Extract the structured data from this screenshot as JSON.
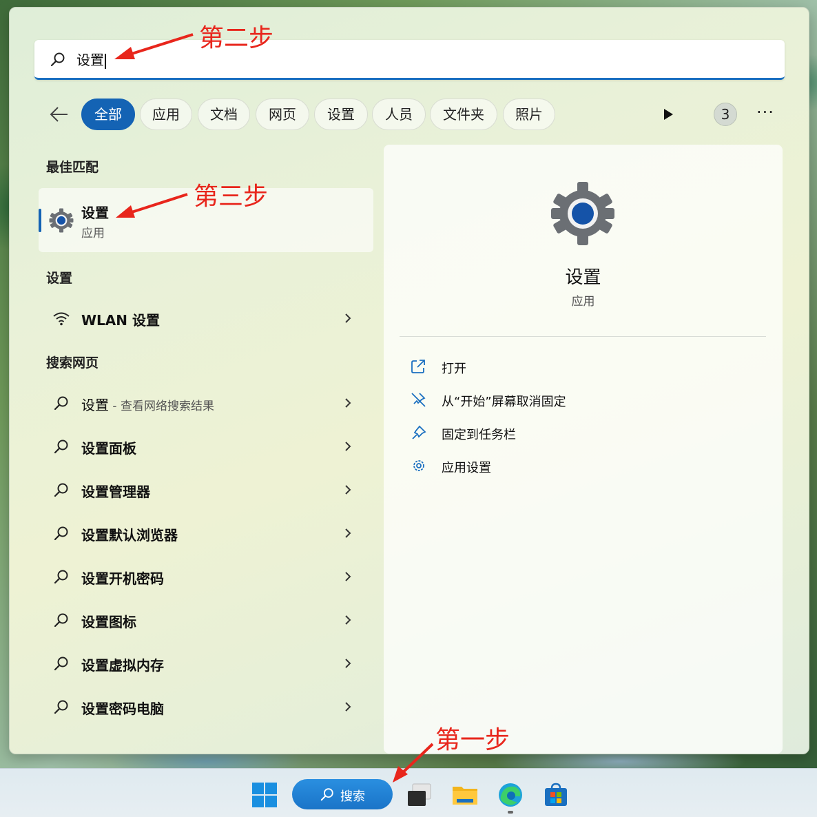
{
  "search": {
    "query": "设置",
    "icon": "search-icon"
  },
  "filters": {
    "back_icon": "arrow-left-icon",
    "chips": [
      "全部",
      "应用",
      "文档",
      "网页",
      "设置",
      "人员",
      "文件夹",
      "照片"
    ],
    "active": "全部",
    "play_icon": "play-icon",
    "badge_count": "3",
    "more_label": "···"
  },
  "best_match": {
    "heading": "最佳匹配",
    "name": "设置",
    "type": "应用",
    "icon": "gear-icon"
  },
  "settings_section": {
    "heading": "设置",
    "items": [
      {
        "label": "WLAN 设置",
        "icon": "wifi-icon"
      }
    ]
  },
  "web_section": {
    "heading": "搜索网页",
    "items": [
      {
        "label": "设置",
        "hint": " - 查看网络搜索结果",
        "icon": "search-icon"
      },
      {
        "label": "设置面板",
        "icon": "search-icon"
      },
      {
        "label": "设置管理器",
        "icon": "search-icon"
      },
      {
        "label": "设置默认浏览器",
        "icon": "search-icon"
      },
      {
        "label": "设置开机密码",
        "icon": "search-icon"
      },
      {
        "label": "设置图标",
        "icon": "search-icon"
      },
      {
        "label": "设置虚拟内存",
        "icon": "search-icon"
      },
      {
        "label": "设置密码电脑",
        "icon": "search-icon"
      }
    ]
  },
  "detail": {
    "name": "设置",
    "type": "应用",
    "actions": [
      {
        "label": "打开",
        "icon": "open-external-icon"
      },
      {
        "label": "从“开始”屏幕取消固定",
        "icon": "unpin-icon"
      },
      {
        "label": "固定到任务栏",
        "icon": "pin-icon"
      },
      {
        "label": "应用设置",
        "icon": "gear-icon"
      }
    ]
  },
  "taskbar": {
    "search_label": "搜索",
    "items": [
      "windows-start-icon",
      "search-icon",
      "task-view-icon",
      "file-explorer-icon",
      "edge-browser-icon",
      "store-icon"
    ]
  },
  "annotations": {
    "step1": "第一步",
    "step2": "第二步",
    "step3": "第三步",
    "color": "#e8261c"
  },
  "colors": {
    "accent": "#1463b4"
  }
}
